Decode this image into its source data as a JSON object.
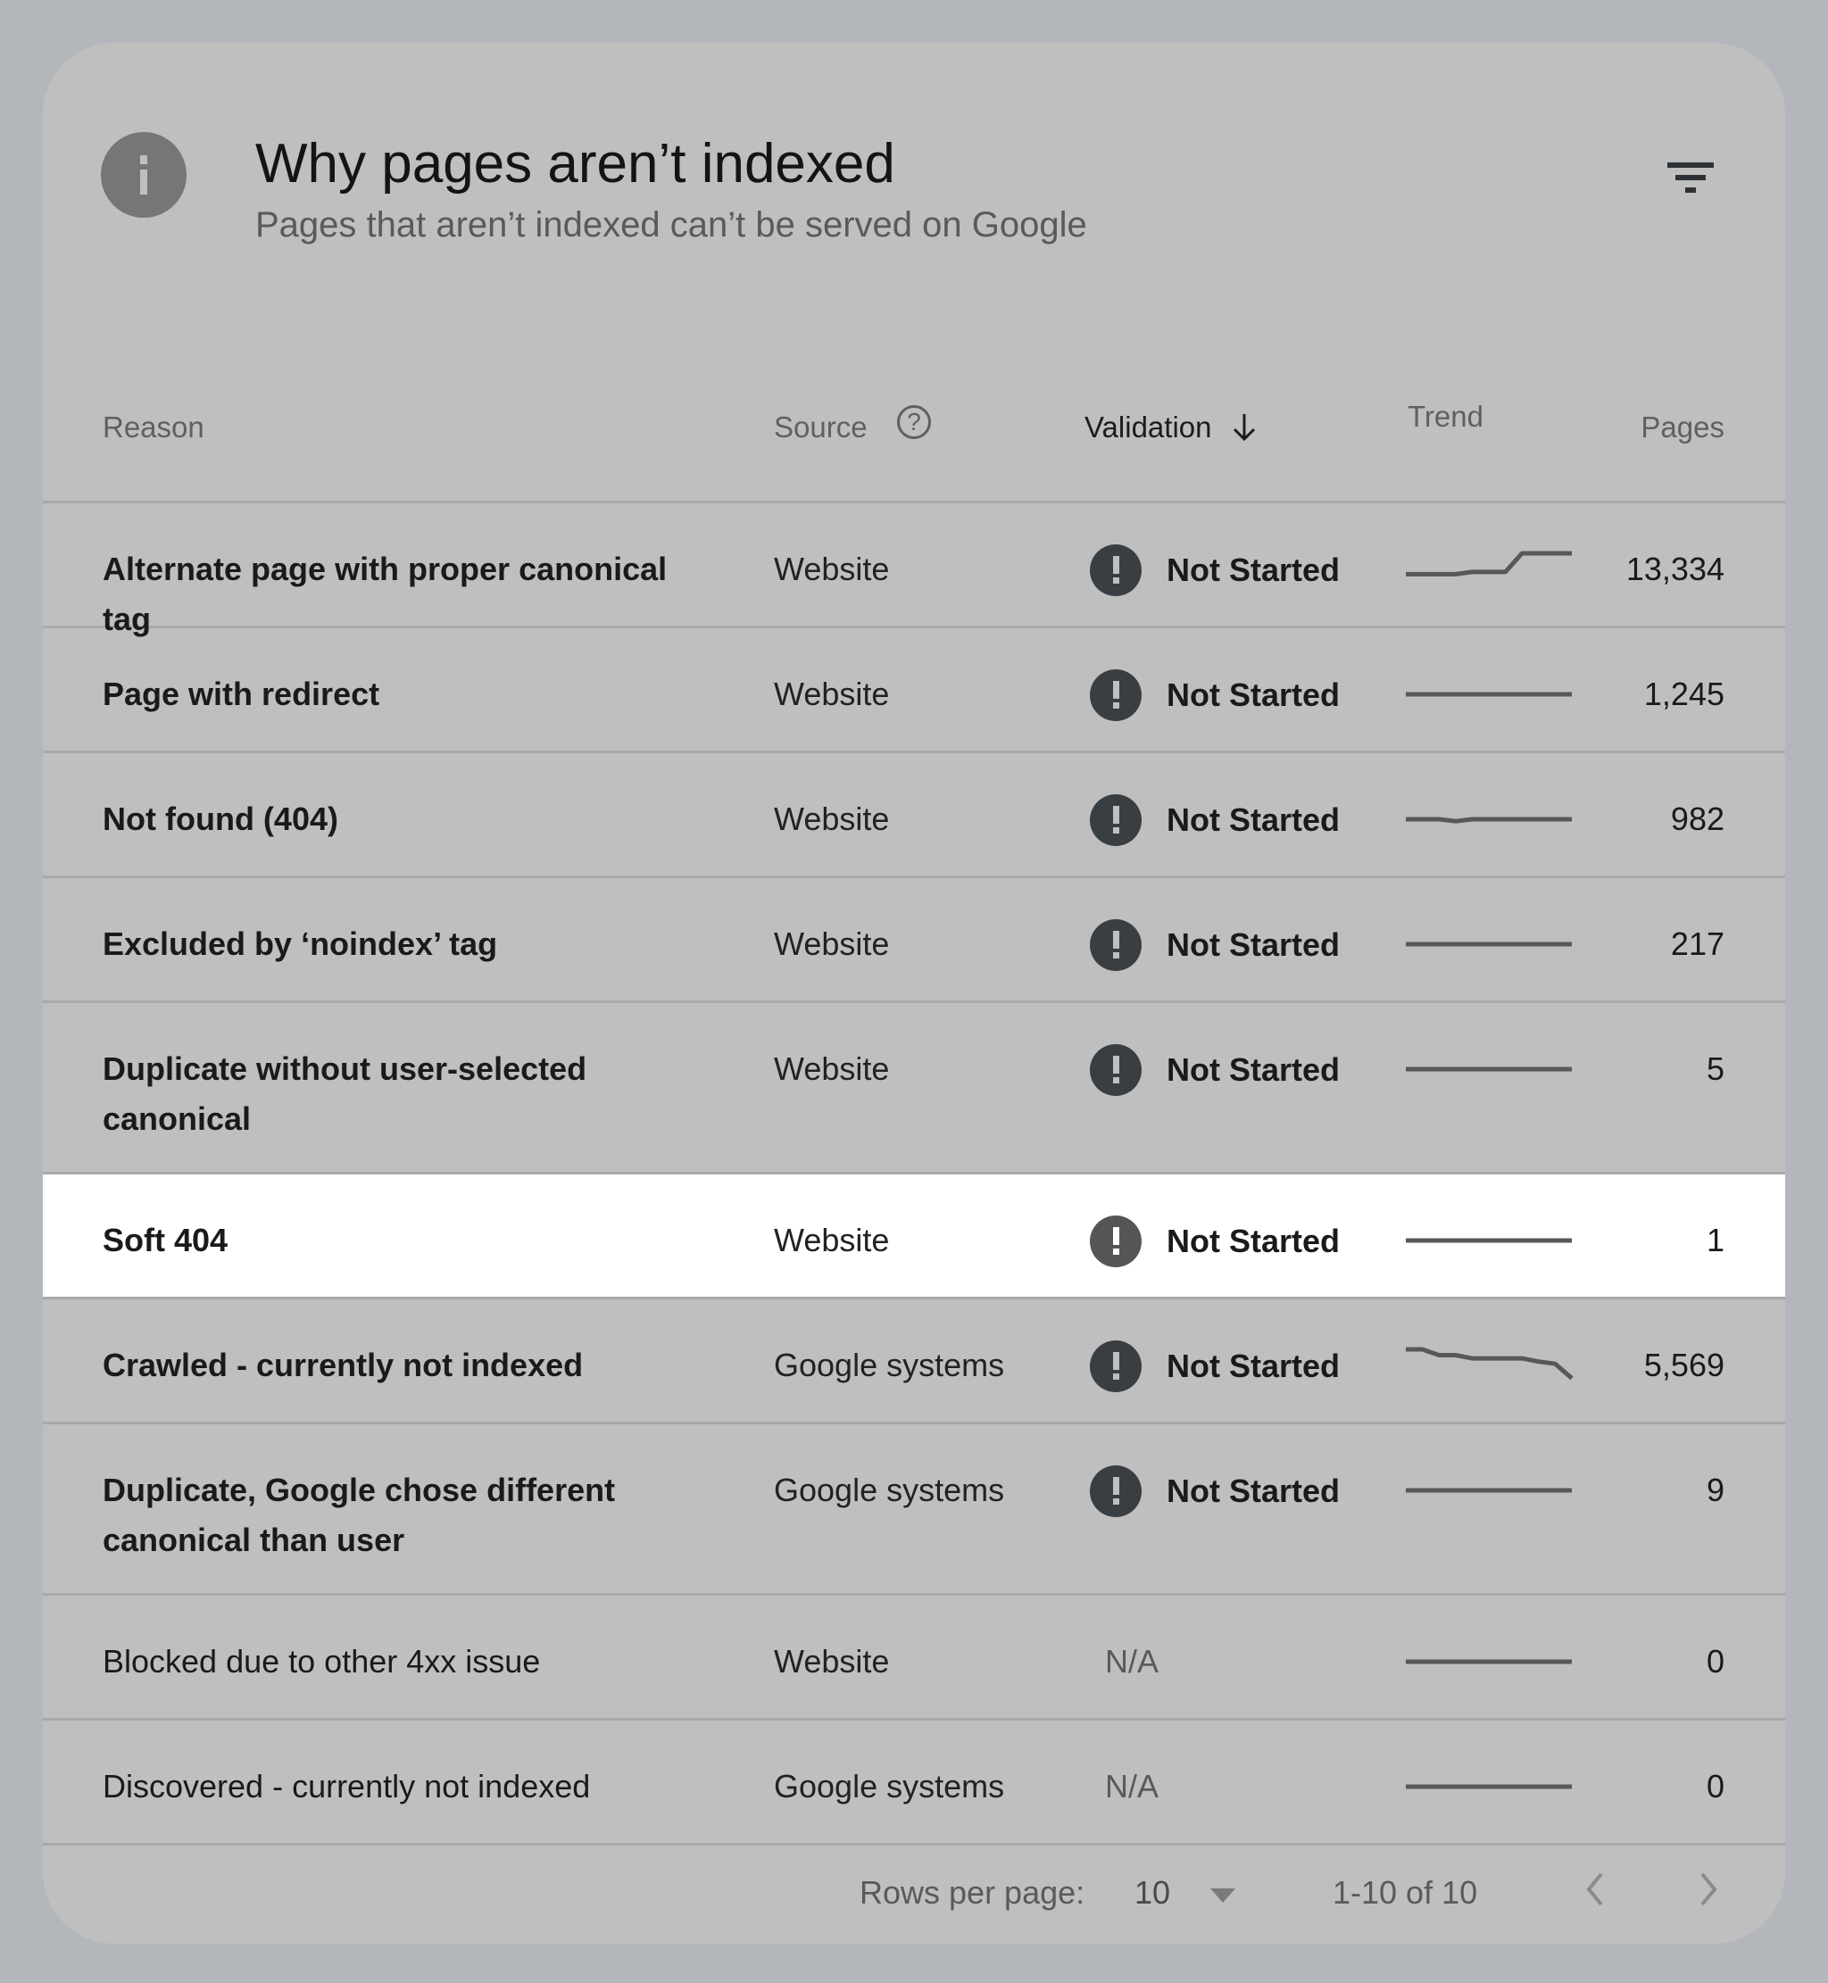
{
  "header": {
    "title": "Why pages aren’t indexed",
    "subtitle": "Pages that aren’t indexed can’t be served on Google",
    "info_icon": "info-icon",
    "filter_icon": "filter-icon"
  },
  "table": {
    "columns": {
      "reason": "Reason",
      "source": "Source",
      "validation": "Validation",
      "trend": "Trend",
      "pages": "Pages"
    },
    "sort": {
      "column": "Validation",
      "direction": "descending"
    },
    "rows": [
      {
        "reason": "Alternate page with proper canonical tag",
        "source": "Website",
        "validation": "Not Started",
        "pages": "13,334",
        "bold": true,
        "trend": [
          0.35,
          0.35,
          0.35,
          0.35,
          0.42,
          0.42,
          0.42,
          1,
          1,
          1,
          1
        ]
      },
      {
        "reason": "Page with redirect",
        "source": "Website",
        "validation": "Not Started",
        "pages": "1,245",
        "bold": true,
        "trend": [
          0.5,
          0.5,
          0.5,
          0.5,
          0.5,
          0.5,
          0.5,
          0.5,
          0.5,
          0.5,
          0.5
        ]
      },
      {
        "reason": "Not found (404)",
        "source": "Website",
        "validation": "Not Started",
        "pages": "982",
        "bold": true,
        "trend": [
          0.5,
          0.5,
          0.5,
          0.44,
          0.5,
          0.5,
          0.5,
          0.5,
          0.5,
          0.5,
          0.5
        ]
      },
      {
        "reason": "Excluded by ‘noindex’ tag",
        "source": "Website",
        "validation": "Not Started",
        "pages": "217",
        "bold": true,
        "trend": [
          0.5,
          0.5,
          0.5,
          0.5,
          0.5,
          0.5,
          0.5,
          0.5,
          0.5,
          0.5,
          0.5
        ]
      },
      {
        "reason": "Duplicate without user-selected canonical",
        "source": "Website",
        "validation": "Not Started",
        "pages": "5",
        "bold": true,
        "trend": [
          0.5,
          0.5,
          0.5,
          0.5,
          0.5,
          0.5,
          0.5,
          0.5,
          0.5,
          0.5,
          0.5
        ]
      },
      {
        "reason": "Soft 404",
        "source": "Website",
        "validation": "Not Started",
        "pages": "1",
        "bold": true,
        "selected": true,
        "trend": [
          0.5,
          0.5,
          0.5,
          0.5,
          0.5,
          0.5,
          0.5,
          0.5,
          0.5,
          0.5,
          0.5
        ]
      },
      {
        "reason": "Crawled - currently not indexed",
        "source": "Google systems",
        "validation": "Not Started",
        "pages": "5,569",
        "bold": true,
        "trend": [
          1,
          1,
          0.82,
          0.82,
          0.72,
          0.72,
          0.72,
          0.72,
          0.62,
          0.55,
          0.1
        ]
      },
      {
        "reason": "Duplicate, Google chose different canonical than user",
        "source": "Google systems",
        "validation": "Not Started",
        "pages": "9",
        "bold": true,
        "trend": [
          0.5,
          0.5,
          0.5,
          0.5,
          0.5,
          0.5,
          0.5,
          0.5,
          0.5,
          0.5,
          0.5
        ]
      },
      {
        "reason": "Blocked due to other 4xx issue",
        "source": "Website",
        "validation": "N/A",
        "pages": "0",
        "bold": false,
        "trend": [
          0.5,
          0.5,
          0.5,
          0.5,
          0.5,
          0.5,
          0.5,
          0.5,
          0.5,
          0.5,
          0.5
        ]
      },
      {
        "reason": "Discovered - currently not indexed",
        "source": "Google systems",
        "validation": "N/A",
        "pages": "0",
        "bold": false,
        "trend": [
          0.5,
          0.5,
          0.5,
          0.5,
          0.5,
          0.5,
          0.5,
          0.5,
          0.5,
          0.5,
          0.5
        ]
      }
    ]
  },
  "footer": {
    "rows_per_page_label": "Rows per page:",
    "rows_per_page_value": "10",
    "range": "1-10 of 10",
    "prev_icon": "chevron-left-icon",
    "next_icon": "chevron-right-icon"
  }
}
